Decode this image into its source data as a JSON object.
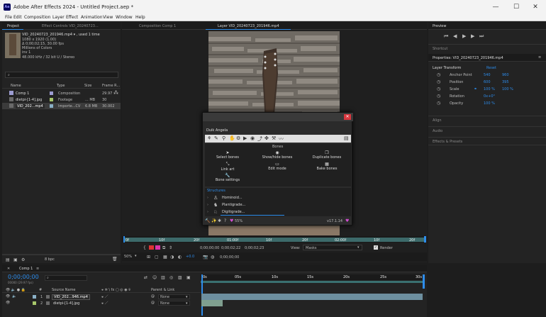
{
  "window": {
    "title": "Adobe After Effects 2024 - Untitled Project.aep *",
    "logo": "Ae"
  },
  "menu": [
    "File",
    "Edit",
    "Composition",
    "Layer",
    "Effect",
    "Animation",
    "View",
    "Window",
    "Help"
  ],
  "project_panel": {
    "tab": "Project",
    "tab2": "Effect Controls VID_20240723...",
    "file_name": "VID_20240723_201946.mp4 ▾ , used 1 time",
    "info1": "1080 x 1920 (1.00)",
    "info2": "Δ 0;00;02;15, 30.00 fps",
    "info3": "Millions of Colors",
    "info4": "inv 1",
    "info5": "48.000 kHz / 32 bit U / Stereo",
    "search_placeholder": "⌕",
    "columns": {
      "name": "Name",
      "type": "Type",
      "size": "Size",
      "frame": "Frame R..."
    },
    "items": [
      {
        "name": "Comp 1",
        "type": "Composition",
        "size": "",
        "frame": "29.97",
        "color": "#9c9cd1"
      },
      {
        "name": "dietpi-[1-4].jpg",
        "type": "Footage",
        "size": "... MB",
        "frame": "30",
        "color": "#a7c76b"
      },
      {
        "name": "VID_202...mp4",
        "type": "Importe...CV",
        "size": "6.8 MB",
        "frame": "30.002",
        "color": "#8ab0c6"
      }
    ],
    "bpc": "8 bpc"
  },
  "comp_panel": {
    "tab": "Composition Comp 1",
    "tab2": "Layer VID_20240723_201946.mp4"
  },
  "duik": {
    "title": "Duik Angela",
    "section": "Bones",
    "buttons": [
      {
        "label": "Select bones"
      },
      {
        "label": "Show/hide bones"
      },
      {
        "label": "Duplicate bones"
      },
      {
        "label": "Link art"
      },
      {
        "label": "Edit mode"
      },
      {
        "label": "Bake bones"
      },
      {
        "label": "Bone settings"
      }
    ],
    "structures_label": "Structures",
    "structures": [
      "Hominoid...",
      "Plantigrade...",
      "Digitigrade..."
    ],
    "percent": "55%",
    "version": "v17.1.14"
  },
  "timeline_ruler": [
    "0f",
    "10f",
    "20f",
    "01:00f",
    "10f",
    "20f",
    "02:00f",
    "10f",
    "20f"
  ],
  "viewer_controls": {
    "zoom": "50%",
    "time1": "0;00;00;00",
    "time2": "0;00;02;22",
    "time3": "0;00;02;23",
    "view_label": "View:",
    "view_value": "Masks",
    "render_label": "Render",
    "plus": "+0.0",
    "time4": "0;00;00;00",
    "time5": "0;00;00;00"
  },
  "preview": {
    "tab": "Preview",
    "shortcut": "Shortcut"
  },
  "properties": {
    "title": "Properties: VID_20240723_201946.mp4",
    "section": "Layer Transform",
    "reset": "Reset",
    "rows": [
      {
        "name": "Anchor Point",
        "v1": "540",
        "v2": "960"
      },
      {
        "name": "Position",
        "v1": "600",
        "v2": "395"
      },
      {
        "name": "Scale",
        "v1": "100 %",
        "v2": "100 %"
      },
      {
        "name": "Rotation",
        "v1": "0x+0°",
        "v2": ""
      },
      {
        "name": "Opacity",
        "v1": "100 %",
        "v2": ""
      }
    ],
    "align": "Align",
    "audio": "Audio",
    "effects": "Effects & Presets"
  },
  "timeline": {
    "tab": "Comp 1",
    "timecode": "0;00;00;00",
    "fps": "00000 (29.97 fps)",
    "ruler": [
      "0s",
      "05s",
      "10s",
      "15s",
      "20s",
      "25s",
      "30s"
    ],
    "cols": {
      "num": "#",
      "source": "Source Name",
      "parent": "Parent & Link"
    },
    "layers": [
      {
        "num": "1",
        "name": "VID_202...946.mp4",
        "parent": "None",
        "color": "#8ab0c6"
      },
      {
        "num": "2",
        "name": "dietpi-[1-4].jpg",
        "parent": "None",
        "color": "#a7c76b"
      }
    ]
  }
}
